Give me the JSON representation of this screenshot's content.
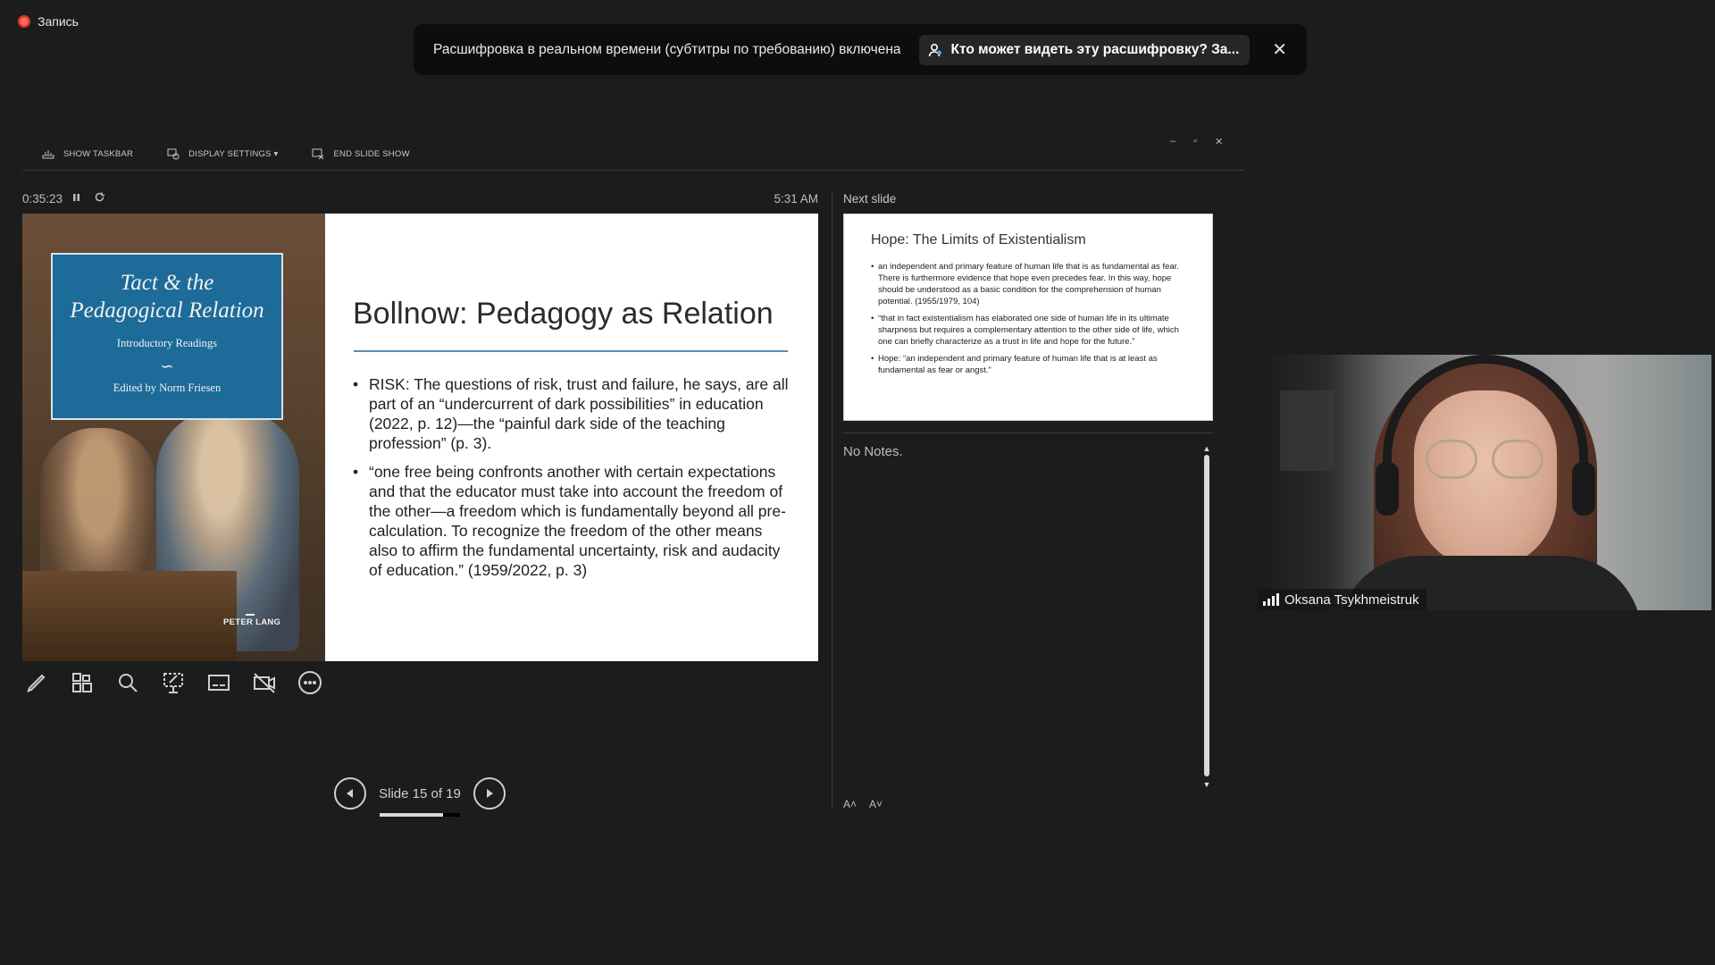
{
  "recording": {
    "label": "Запись"
  },
  "banner": {
    "message": "Расшифровка в реальном времени (субтитры по требованию) включена",
    "who_can_see": "Кто может видеть эту расшифровку? За...",
    "close_glyph": "✕"
  },
  "toolbar": {
    "show_taskbar": "SHOW TASKBAR",
    "display_settings": "DISPLAY SETTINGS ▾",
    "end_slide_show": "END SLIDE SHOW"
  },
  "window_controls": {
    "minimize": "–",
    "restore": "▫",
    "close": "✕"
  },
  "timer": {
    "elapsed": "0:35:23",
    "clock": "5:31 AM"
  },
  "current_slide": {
    "book": {
      "title_line1": "Tact & the",
      "title_line2": "Pedagogical Relation",
      "subtitle": "Introductory Readings",
      "swash": "∽",
      "editor": "Edited by Norm Friesen",
      "publisher": "PETER LANG"
    },
    "title": "Bollnow: Pedagogy as Relation",
    "bullets": [
      "RISK: The questions of risk, trust and failure, he says, are all part of an “undercurrent of dark possibilities” in education (2022, p. 12)—the “painful dark side of the teaching profession” (p. 3).",
      "“one free being confronts another with certain expectations and that the educator must take into account the freedom of the other—a freedom which is fundamentally beyond all pre-calculation. To recognize the freedom of the other means also to affirm the fundamental uncertainty, risk and audacity of education.” (1959/2022, p. 3)"
    ]
  },
  "navigation": {
    "counter": "Slide 15 of 19",
    "current": 15,
    "total": 19,
    "progress": 0.79
  },
  "next_slide": {
    "label": "Next slide",
    "title": "Hope: The Limits of Existentialism",
    "bullets": [
      "an independent and primary feature of human life that is as fundamental as fear. There is furthermore evidence that hope even precedes fear. In this way, hope should be understood as a basic condition for the comprehension of human potential. (1955/1979, 104)",
      "“that in fact existentialism has elaborated one side of human life in its ultimate sharpness but requires a complementary attention to the other side of life, which one can briefly characterize as a trust in life and hope for the future.”",
      "Hope: “an independent and primary feature of human life that is at least as fundamental as fear or angst.”"
    ]
  },
  "notes": {
    "text": "No Notes.",
    "increase_font": "A˄",
    "decrease_font": "A˅"
  },
  "webcam": {
    "participant_name": "Oksana Tsykhmeistruk"
  },
  "colors": {
    "background": "#1c1c1c",
    "book_blue": "#1d6b98",
    "title_rule": "#5b8bb3",
    "record_red": "#d9362b"
  }
}
